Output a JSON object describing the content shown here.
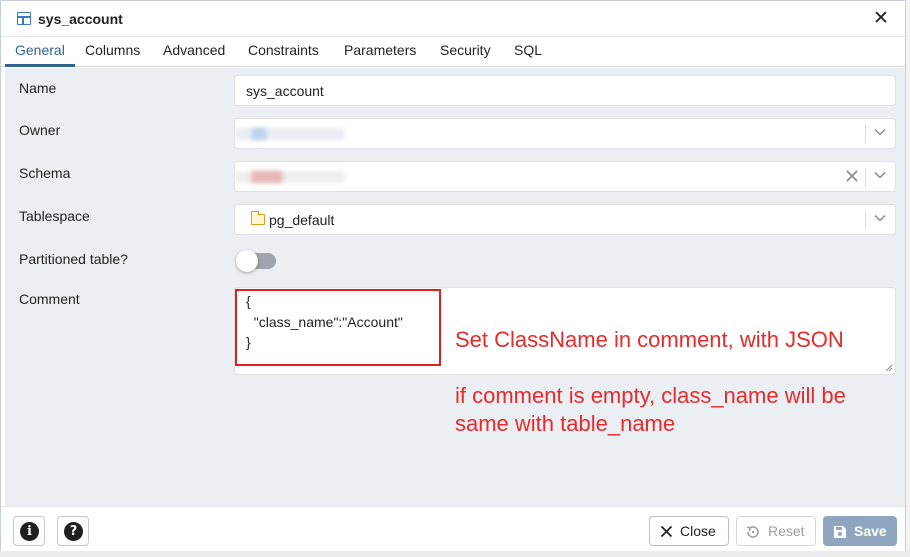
{
  "window": {
    "title": "sys_account",
    "close_glyph": "✕"
  },
  "tabs": [
    {
      "label": "General",
      "active": true
    },
    {
      "label": "Columns",
      "active": false
    },
    {
      "label": "Advanced",
      "active": false
    },
    {
      "label": "Constraints",
      "active": false
    },
    {
      "label": "Parameters",
      "active": false
    },
    {
      "label": "Security",
      "active": false
    },
    {
      "label": "SQL",
      "active": false
    }
  ],
  "form": {
    "name": {
      "label": "Name",
      "value": "sys_account"
    },
    "owner": {
      "label": "Owner",
      "value": ""
    },
    "schema": {
      "label": "Schema",
      "value": ""
    },
    "tablespace": {
      "label": "Tablespace",
      "value": "pg_default"
    },
    "partitioned": {
      "label": "Partitioned table?",
      "value": false
    },
    "comment": {
      "label": "Comment",
      "lines": [
        "{",
        "  \"class_name\":\"Account\"",
        "}"
      ]
    }
  },
  "annotations": {
    "line1": "Set ClassName in comment, with JSON",
    "line2": "if comment is empty, class_name will be",
    "line3": "same with table_name",
    "color": "#e52b2b"
  },
  "footer": {
    "info_glyph": "i",
    "help_glyph": "?",
    "close_label": "Close",
    "reset_label": "Reset",
    "save_label": "Save"
  },
  "colors": {
    "accent": "#326690",
    "body_bg": "#ebeef3",
    "save_disabled": "#8fa6c0",
    "toggle_off": "#9fa5ad"
  },
  "icons": [
    "table-icon",
    "close-icon",
    "chevron-down-icon",
    "clear-x-icon",
    "folder-icon",
    "info-icon",
    "help-icon",
    "save-icon",
    "reset-icon"
  ]
}
